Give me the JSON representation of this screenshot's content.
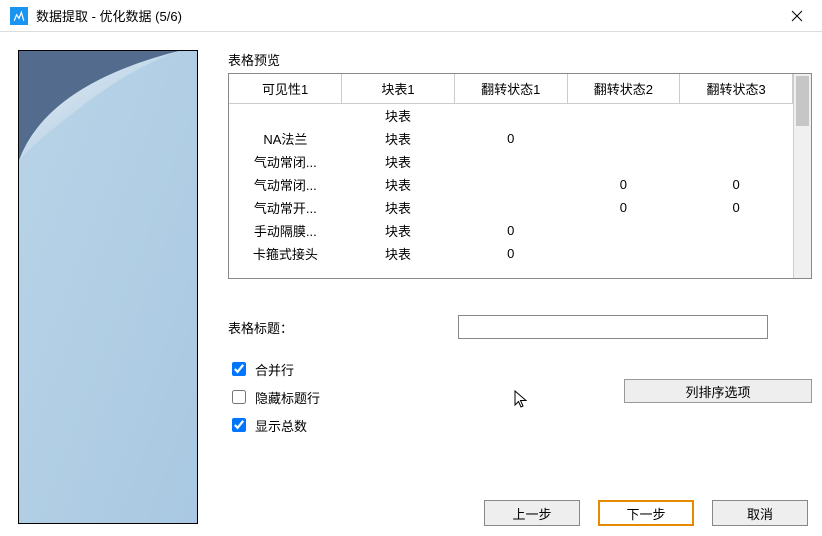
{
  "window": {
    "title": "数据提取 - 优化数据 (5/6)"
  },
  "preview_label": "表格预览",
  "table": {
    "headers": [
      "可见性1",
      "块表1",
      "翻转状态1",
      "翻转状态2",
      "翻转状态3"
    ],
    "rows": [
      [
        "",
        "块表",
        "",
        "",
        ""
      ],
      [
        "NA法兰",
        "块表",
        "0",
        "",
        ""
      ],
      [
        "气动常闭...",
        "块表",
        "",
        "",
        ""
      ],
      [
        "气动常闭...",
        "块表",
        "",
        "0",
        "0"
      ],
      [
        "气动常开...",
        "块表",
        "",
        "0",
        "0"
      ],
      [
        "手动隔膜...",
        "块表",
        "0",
        "",
        ""
      ],
      [
        "卡箍式接头",
        "块表",
        "0",
        "",
        ""
      ]
    ]
  },
  "form": {
    "table_title_label": "表格标题：",
    "table_title_value": ""
  },
  "checks": {
    "merge_rows": {
      "label": "合并行",
      "checked": true
    },
    "hide_title_row": {
      "label": "隐藏标题行",
      "checked": false
    },
    "show_total": {
      "label": "显示总数",
      "checked": true
    }
  },
  "col_sort_button": "列排序选项",
  "footer": {
    "prev": "上一步",
    "next": "下一步",
    "cancel": "取消"
  }
}
